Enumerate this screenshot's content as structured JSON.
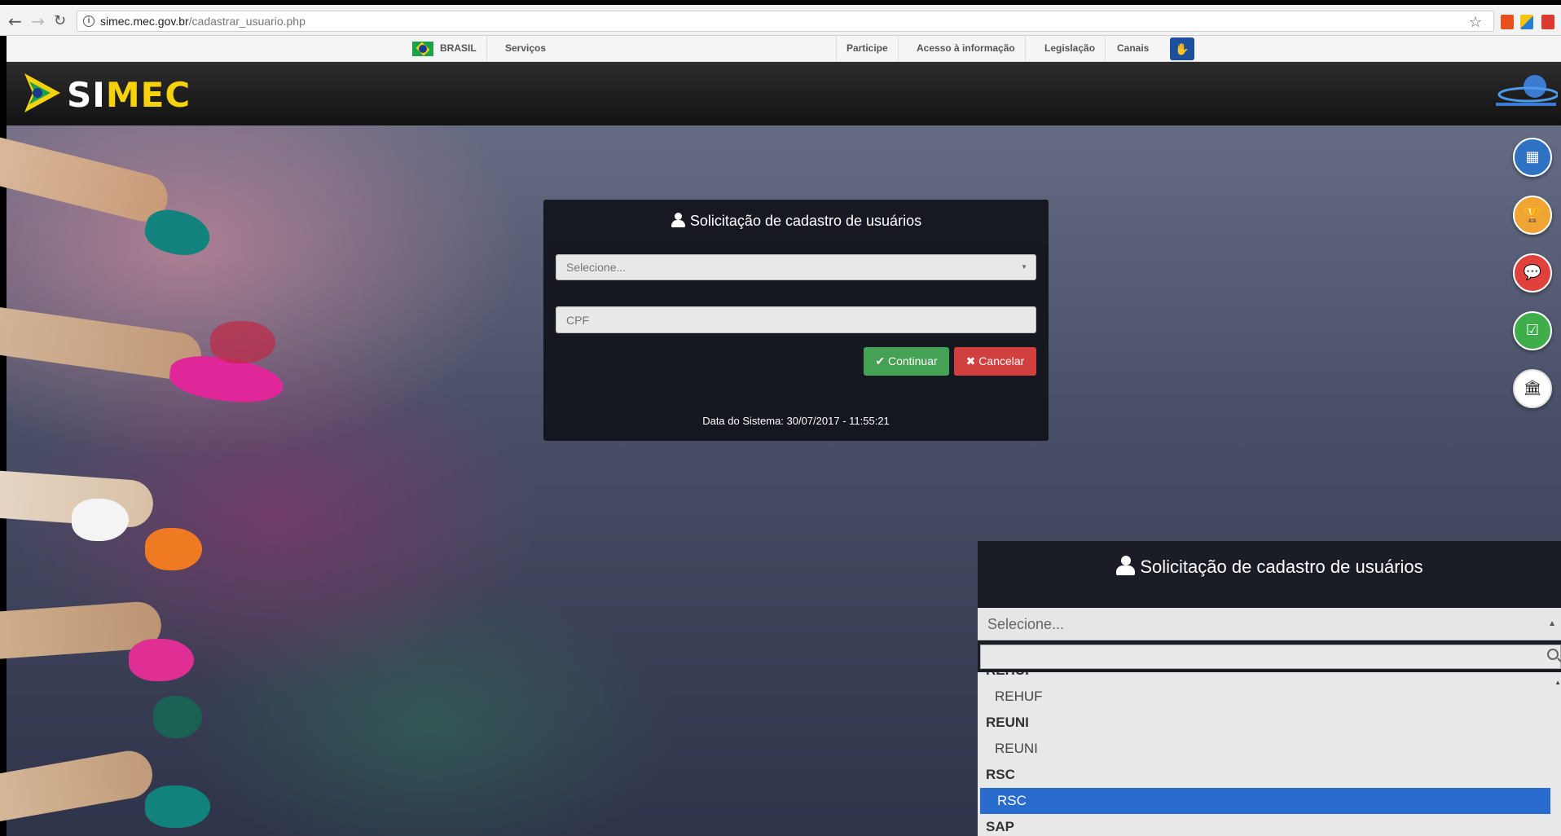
{
  "browser": {
    "url_host": "simec.mec.gov.br",
    "url_path": "/cadastrar_usuario.php",
    "back_icon": "arrow-left-icon",
    "forward_icon": "arrow-right-icon",
    "reload_icon": "reload-icon"
  },
  "gov_bar": {
    "brasil": "BRASIL",
    "servicos": "Serviços",
    "participe": "Participe",
    "acesso": "Acesso à informação",
    "legislacao": "Legislação",
    "canais": "Canais"
  },
  "header": {
    "logo_text_1": "SI",
    "logo_text_2": "MEC"
  },
  "side_buttons": [
    {
      "icon": "grid-icon",
      "color": "#2f72c3"
    },
    {
      "icon": "trophy-icon",
      "color": "#f0a431"
    },
    {
      "icon": "chat-icon",
      "color": "#e0413d"
    },
    {
      "icon": "checkbox-icon",
      "color": "#3fae4a"
    },
    {
      "icon": "bank-icon",
      "color": "#ffffff"
    }
  ],
  "form": {
    "title": "Solicitação de cadastro de usuários",
    "select_placeholder": "Selecione...",
    "cpf_placeholder": "CPF",
    "continue_label": "Continuar",
    "cancel_label": "Cancelar",
    "system_date": "Data do Sistema: 30/07/2017 - 11:55:21"
  },
  "zoom": {
    "title": "Solicitação de cadastro de usuários",
    "select_value": "Selecione...",
    "options": [
      {
        "label": "REHUF",
        "kind": "group",
        "partial": true
      },
      {
        "label": "REHUF",
        "kind": "child"
      },
      {
        "label": "REUNI",
        "kind": "group"
      },
      {
        "label": "REUNI",
        "kind": "child"
      },
      {
        "label": "RSC",
        "kind": "group"
      },
      {
        "label": "RSC",
        "kind": "child",
        "selected": true
      },
      {
        "label": "SAP",
        "kind": "group"
      }
    ]
  }
}
